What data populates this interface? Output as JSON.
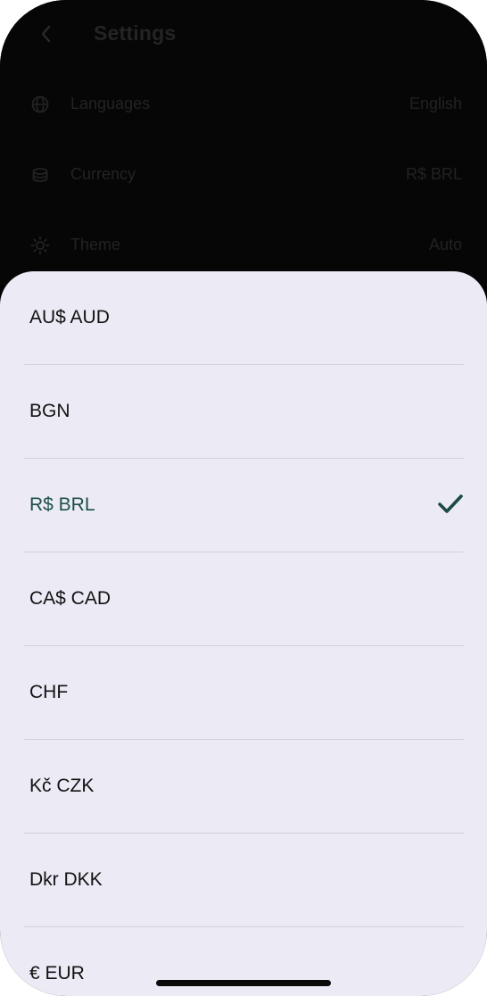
{
  "settings": {
    "title": "Settings",
    "rows": [
      {
        "icon": "globe-icon",
        "label": "Languages",
        "value": "English"
      },
      {
        "icon": "coins-icon",
        "label": "Currency",
        "value": "R$ BRL"
      },
      {
        "icon": "sun-icon",
        "label": "Theme",
        "value": "Auto"
      }
    ]
  },
  "currency_sheet": {
    "options": [
      {
        "label": "AU$ AUD",
        "selected": false
      },
      {
        "label": "BGN",
        "selected": false
      },
      {
        "label": "R$ BRL",
        "selected": true
      },
      {
        "label": "CA$ CAD",
        "selected": false
      },
      {
        "label": "CHF",
        "selected": false
      },
      {
        "label": "Kč CZK",
        "selected": false
      },
      {
        "label": "Dkr DKK",
        "selected": false
      },
      {
        "label": "€ EUR",
        "selected": false
      }
    ]
  },
  "colors": {
    "sheet_background": "#eceaf5",
    "selected_text": "#1b5048",
    "divider": "#d3d2da"
  }
}
